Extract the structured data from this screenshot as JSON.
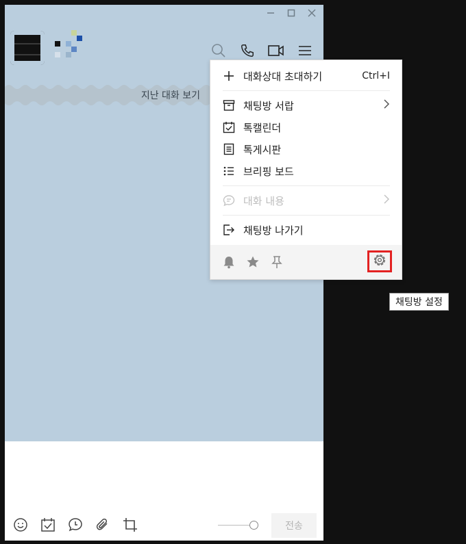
{
  "window": {
    "controls": {
      "minimize_icon": "minimize-icon",
      "maximize_icon": "maximize-icon",
      "close_icon": "close-icon"
    }
  },
  "header": {
    "icons": [
      "search-icon",
      "phone-icon",
      "video-icon",
      "menu-icon"
    ]
  },
  "chat": {
    "past_label": "지난 대화 보기"
  },
  "menu": {
    "invite": {
      "label": "대화상대 초대하기",
      "shortcut": "Ctrl+I"
    },
    "drawer": {
      "label": "채팅방 서랍"
    },
    "calendar": {
      "label": "톡캘린더"
    },
    "board": {
      "label": "톡게시판"
    },
    "briefing": {
      "label": "브리핑 보드"
    },
    "content": {
      "label": "대화 내용"
    },
    "leave": {
      "label": "채팅방 나가기"
    },
    "footer_icons": [
      "bell-icon",
      "star-icon",
      "pin-icon",
      "gear-icon"
    ]
  },
  "tooltip": {
    "text": "채팅방 설정"
  },
  "composer": {
    "send_label": "전송",
    "toolbar_icons": [
      "emoji-icon",
      "calendar-check-icon",
      "chat-bubble-icon",
      "attach-icon",
      "crop-icon"
    ]
  },
  "colors": {
    "chat_bg": "#bacede",
    "highlight": "#e32222"
  }
}
